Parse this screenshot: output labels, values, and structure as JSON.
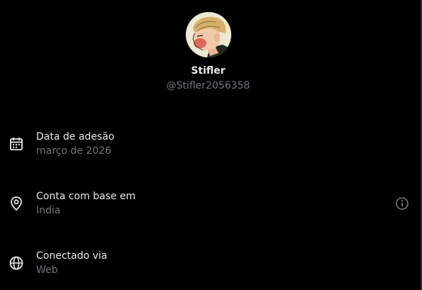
{
  "profile": {
    "display_name": "Stifler",
    "handle": "@Stifler2056358"
  },
  "rows": [
    {
      "icon": "calendar-icon",
      "label": "Data de adesão",
      "value": "março de 2026"
    },
    {
      "icon": "location-pin-icon",
      "label": "Conta com base em",
      "value": "India",
      "info_icon": "info-icon"
    },
    {
      "icon": "globe-icon",
      "label": "Conectado via",
      "value": "Web"
    }
  ],
  "colors": {
    "background": "#000000",
    "primary_text": "#e7e9ea",
    "secondary_text": "#71767b"
  }
}
